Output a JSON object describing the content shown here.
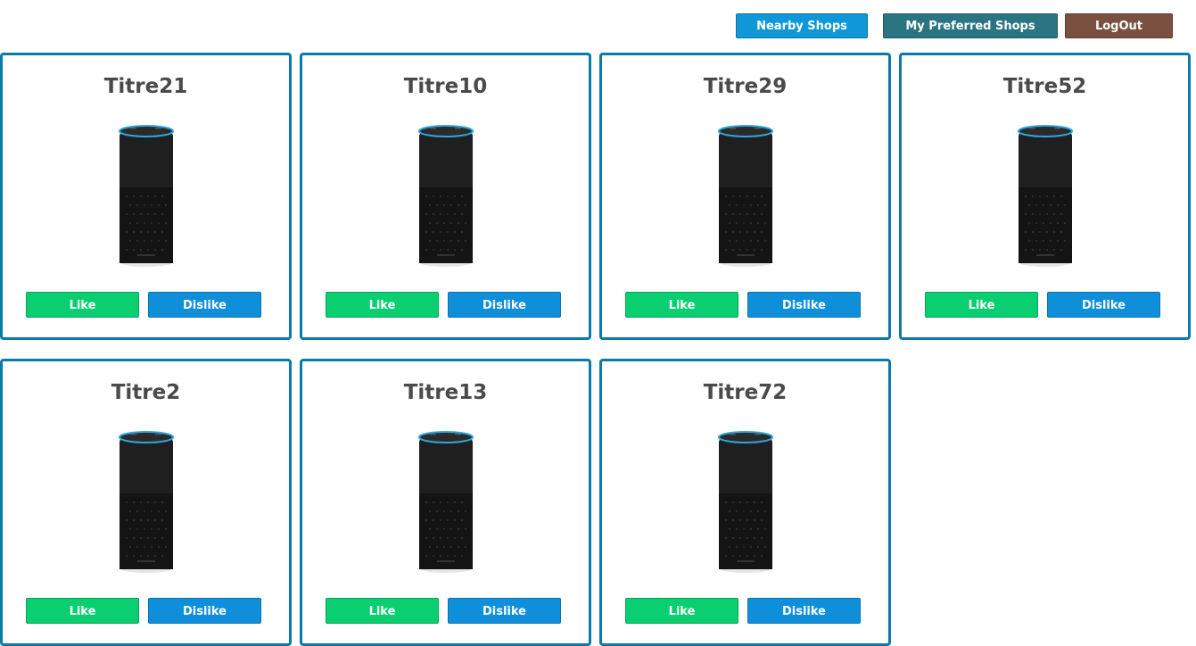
{
  "nav": {
    "nearby_label": "Nearby Shops",
    "preferred_label": "My Preferred Shops",
    "logout_label": "LogOut"
  },
  "colors": {
    "nearby": "#0f97d8",
    "preferred": "#2b7583",
    "logout": "#7a5040",
    "like": "#09cf70",
    "dislike": "#0f8fd9",
    "card_border": "#0a7aa8"
  },
  "shop_image_icon": "smart-speaker-icon",
  "shops": [
    {
      "title": "Titre21",
      "like_label": "Like",
      "dislike_label": "Dislike"
    },
    {
      "title": "Titre10",
      "like_label": "Like",
      "dislike_label": "Dislike"
    },
    {
      "title": "Titre29",
      "like_label": "Like",
      "dislike_label": "Dislike"
    },
    {
      "title": "Titre52",
      "like_label": "Like",
      "dislike_label": "Dislike"
    },
    {
      "title": "Titre2",
      "like_label": "Like",
      "dislike_label": "Dislike"
    },
    {
      "title": "Titre13",
      "like_label": "Like",
      "dislike_label": "Dislike"
    },
    {
      "title": "Titre72",
      "like_label": "Like",
      "dislike_label": "Dislike"
    }
  ]
}
